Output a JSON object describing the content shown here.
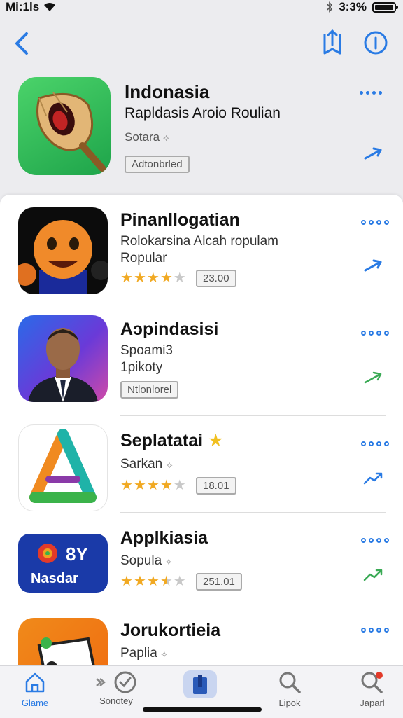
{
  "status": {
    "carrier": "Mi:1ls",
    "battery": "3:3%"
  },
  "featured": {
    "title": "Indonasia",
    "subtitle": "Rapldasis Aroio Roulian",
    "category": "Sotara",
    "badge": "Adtonbrled"
  },
  "apps": [
    {
      "title": "Pinanllogatian",
      "line1": "Rolokarsina Alcah ropulam",
      "line2": "Ropular",
      "rating": 4,
      "count": "23.00"
    },
    {
      "title": "Aɔpindasisi",
      "line1": "Spoami3",
      "line2": "1pikoty",
      "tag": "Ntlonlorel"
    },
    {
      "title": "Seplatatai",
      "line1": "Sarkan",
      "rating": 4,
      "count": "18.01"
    },
    {
      "title": "Applkiasia",
      "line1": "Sopula",
      "rating": 3.5,
      "count": "251.01"
    },
    {
      "title": "Jorukortieia",
      "line1": "Paplia"
    }
  ],
  "app_icons": {
    "nasdar_top": "8Y",
    "nasdar_bottom": "Nasdar"
  },
  "tabs": [
    {
      "label": "Glame",
      "icon": "home-icon"
    },
    {
      "label": "Sonotey",
      "icon": "check-circle-icon"
    },
    {
      "label": "",
      "icon": "store-icon"
    },
    {
      "label": "Lipok",
      "icon": "search-icon"
    },
    {
      "label": "Japarl",
      "icon": "search-badge-icon"
    }
  ],
  "colors": {
    "accent": "#2a7be4",
    "green_action": "#3aaa55",
    "star": "#f1a922"
  }
}
